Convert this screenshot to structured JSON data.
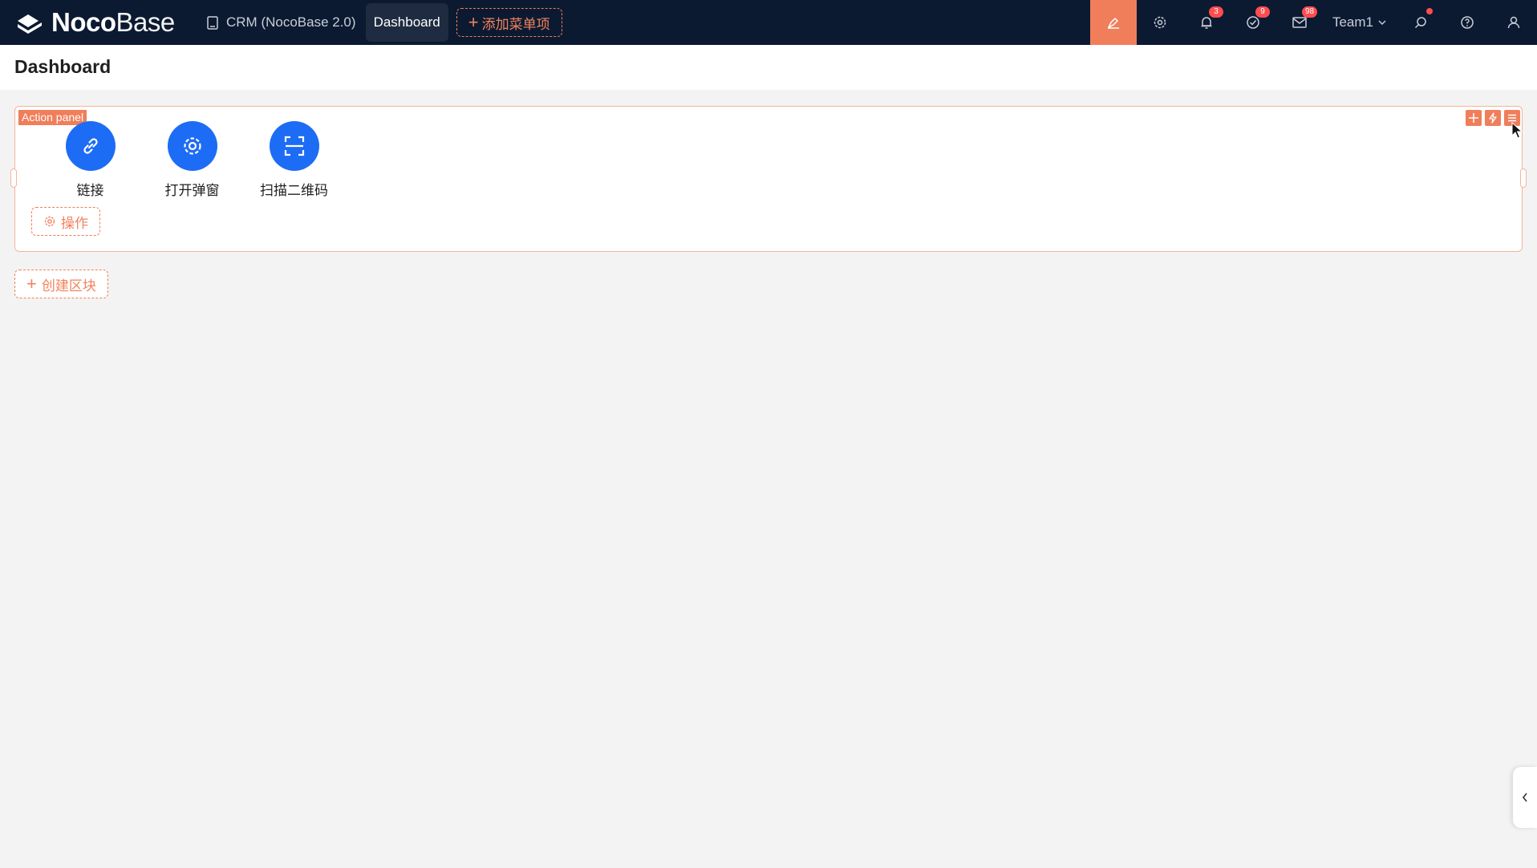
{
  "app": {
    "logo_bold": "Noco",
    "logo_light": "Base"
  },
  "topnav": {
    "items": [
      {
        "label": "CRM (NocoBase 2.0)",
        "icon": "document-icon"
      },
      {
        "label": "Dashboard",
        "active": true
      }
    ],
    "add_menu_label": "添加菜单项"
  },
  "toolbar": {
    "team_label": "Team1",
    "notifications_count": "3",
    "tasks_count": "9",
    "messages_count": "98",
    "icons": [
      "ui-editor-icon",
      "gear-icon",
      "bell-icon",
      "check-circle-icon",
      "mail-icon",
      "search-icon",
      "help-icon",
      "user-icon"
    ]
  },
  "page": {
    "title": "Dashboard"
  },
  "action_panel": {
    "tag": "Action panel",
    "actions": [
      {
        "label": "链接",
        "icon": "link-icon"
      },
      {
        "label": "打开弹窗",
        "icon": "gear-icon"
      },
      {
        "label": "扫描二维码",
        "icon": "scan-icon"
      }
    ],
    "ops_label": "操作"
  },
  "create_block_label": "创建区块",
  "colors": {
    "topbar": "#0b1a31",
    "accent": "#f07e5a",
    "primary": "#1d6cf5"
  }
}
